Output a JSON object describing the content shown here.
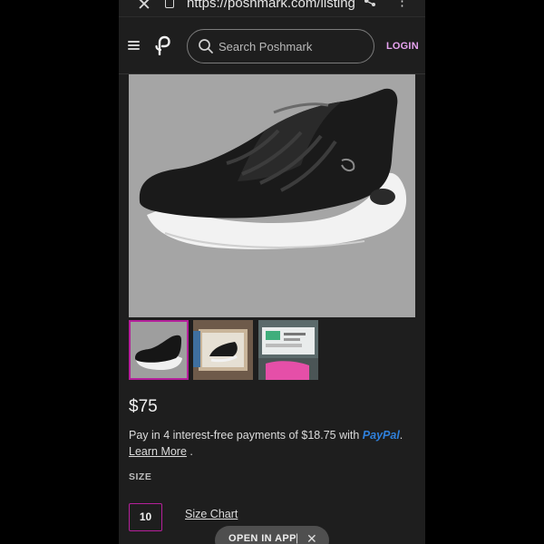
{
  "browser": {
    "url": "https://poshmark.com/listing",
    "close_glyph": "✕",
    "share_glyph": "⋖",
    "more_glyph": "⋮"
  },
  "header": {
    "search_placeholder": "Search Poshmark",
    "login_label": "LOGIN"
  },
  "product": {
    "price": "$75",
    "installment_text": "Pay in 4 interest-free payments of $18.75 with ",
    "paypal_label_a": "Pay",
    "paypal_label_b": "Pal",
    "installment_end": ".",
    "learn_more": "Learn More",
    "learn_more_end": " .",
    "size_heading": "SIZE",
    "size_value": "10",
    "size_chart_label": "Size Chart"
  },
  "banner": {
    "open_app_label": "OPEN IN APP",
    "separator": "|",
    "close_glyph": "✕"
  },
  "colors": {
    "accent": "#b5209b",
    "login": "#e7a3f0",
    "paypal": "#2f7fd9",
    "background": "#1e1e1e"
  },
  "icons": [
    "close-icon",
    "lock-icon",
    "share-icon",
    "more-icon",
    "menu-icon",
    "poshmark-logo",
    "search-icon"
  ]
}
